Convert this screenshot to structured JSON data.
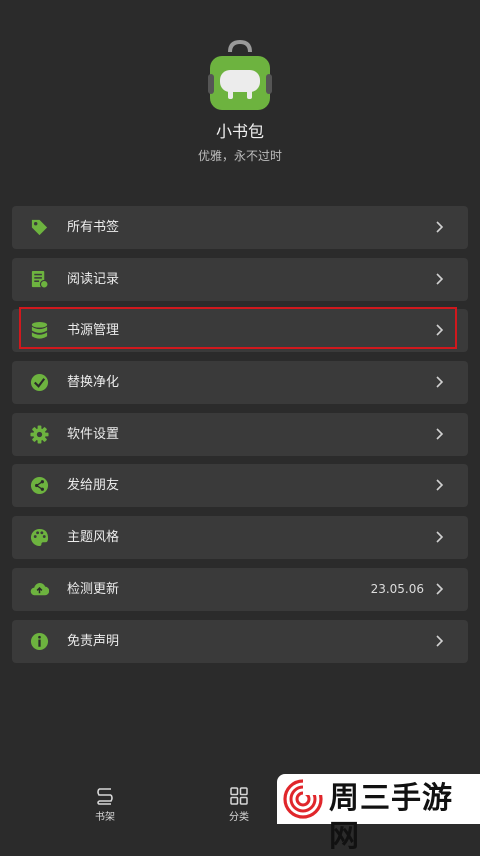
{
  "app": {
    "name": "小书包",
    "slogan": "优雅，永不过时"
  },
  "colors": {
    "accent": "#6db33f",
    "background": "#2b2b2b",
    "card": "#3a3a3a",
    "highlight": "#d0181d"
  },
  "menu": [
    {
      "label": "所有书签",
      "icon": "tag-icon",
      "value": ""
    },
    {
      "label": "阅读记录",
      "icon": "reading-history-icon",
      "value": ""
    },
    {
      "label": "书源管理",
      "icon": "database-icon",
      "value": ""
    },
    {
      "label": "替换净化",
      "icon": "clean-check-icon",
      "value": ""
    },
    {
      "label": "软件设置",
      "icon": "gear-icon",
      "value": ""
    },
    {
      "label": "发给朋友",
      "icon": "share-icon",
      "value": ""
    },
    {
      "label": "主题风格",
      "icon": "palette-icon",
      "value": ""
    },
    {
      "label": "检测更新",
      "icon": "cloud-upload-icon",
      "value": "23.05.06"
    },
    {
      "label": "免责声明",
      "icon": "info-icon",
      "value": ""
    }
  ],
  "bottom_nav": [
    {
      "label": "书架",
      "icon": "bookshelf-icon"
    },
    {
      "label": "分类",
      "icon": "grid-icon"
    }
  ],
  "watermark": {
    "text": "周三手游网"
  }
}
